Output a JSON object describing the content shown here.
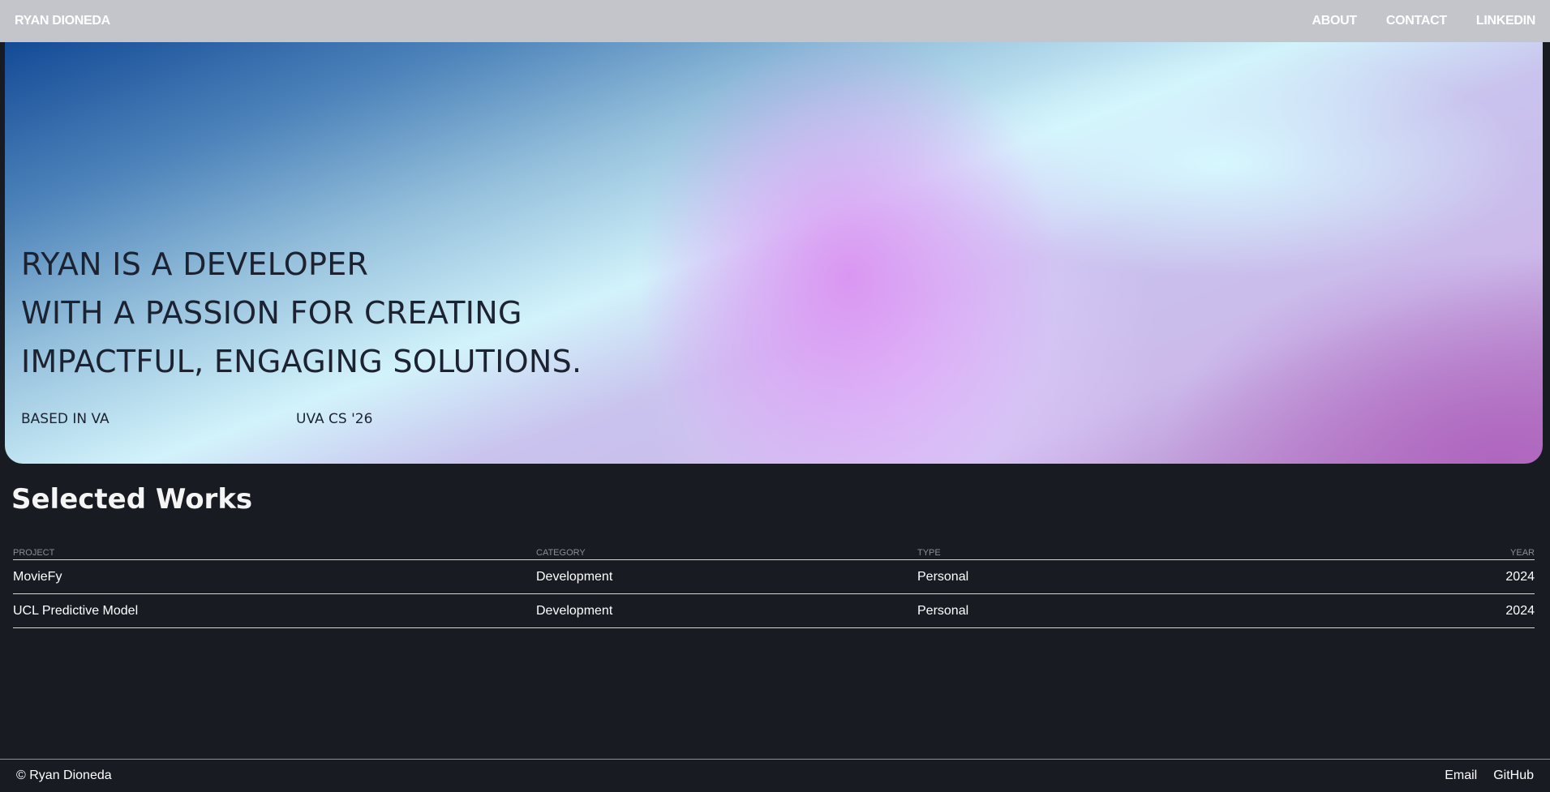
{
  "header": {
    "brand": "RYAN DIONEDA",
    "nav": [
      "ABOUT",
      "CONTACT",
      "LINKEDIN"
    ]
  },
  "hero": {
    "lines": [
      "RYAN IS A DEVELOPER",
      "WITH A PASSION FOR CREATING",
      "IMPACTFUL, ENGAGING SOLUTIONS."
    ],
    "location": "BASED IN VA",
    "education": "UVA CS '26"
  },
  "works": {
    "title": "Selected Works",
    "columns": [
      "PROJECT",
      "CATEGORY",
      "TYPE",
      "YEAR"
    ],
    "rows": [
      [
        "MovieFy",
        "Development",
        "Personal",
        "2024"
      ],
      [
        "UCL Predictive Model",
        "Development",
        "Personal",
        "2024"
      ]
    ]
  },
  "footer": {
    "copyright": "© Ryan Dioneda",
    "links": [
      "Email",
      "GitHub"
    ]
  },
  "colors": {
    "nav_bg": "#c3c5cb",
    "page_bg": "#181b22",
    "hero_text": "#1c2230"
  }
}
